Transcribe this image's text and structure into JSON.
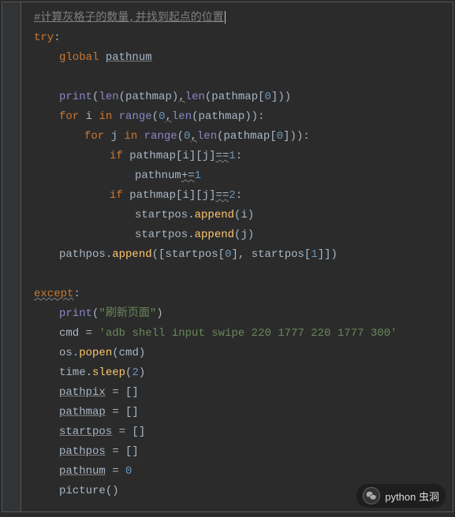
{
  "code": {
    "commentLine": "#计算灰格子的数量,并找到起点的位置",
    "l2_try": "try",
    "l3_global": "global",
    "l3_pathnum": "pathnum",
    "l5_print": "print",
    "l5_len1": "len",
    "l5_pathmap1": "pathmap",
    "l5_len2": "len",
    "l5_pathmap2": "pathmap",
    "l5_zero": "0",
    "l6_for": "for",
    "l6_i": "i",
    "l6_in": "in",
    "l6_range": "range",
    "l6_zero": "0",
    "l6_len": "len",
    "l6_pathmap": "pathmap",
    "l7_for": "for",
    "l7_j": "j",
    "l7_in": "in",
    "l7_range": "range",
    "l7_zero": "0",
    "l7_len": "len",
    "l7_pathmap": "pathmap",
    "l7_idx": "0",
    "l8_if": "if",
    "l8_pathmap": "pathmap",
    "l8_i": "i",
    "l8_j": "j",
    "l8_eq": "==",
    "l8_one": "1",
    "l9_pathnum": "pathnum",
    "l9_plus": "+=",
    "l9_one": "1",
    "l10_if": "if",
    "l10_pathmap": "pathmap",
    "l10_i": "i",
    "l10_j": "j",
    "l10_eq": "==",
    "l10_two": "2",
    "l11_startpos": "startpos",
    "l11_append": "append",
    "l11_i": "i",
    "l12_startpos": "startpos",
    "l12_append": "append",
    "l12_j": "j",
    "l13_pathpos": "pathpos",
    "l13_append": "append",
    "l13_startpos1": "startpos",
    "l13_zero": "0",
    "l13_startpos2": "startpos",
    "l13_one": "1",
    "l15_except": "except",
    "l16_print": "print",
    "l16_str": "\"刷新页面\"",
    "l17_cmd": "cmd",
    "l17_eq": " = ",
    "l17_str": "'adb shell input swipe 220 1777 220 1777 300'",
    "l18_os": "os",
    "l18_popen": "popen",
    "l18_cmd": "cmd",
    "l19_time": "time",
    "l19_sleep": "sleep",
    "l19_two": "2",
    "l20_pathpix": "pathpix",
    "l20_rest": " = []",
    "l21_pathmap": "pathmap",
    "l21_rest": " = []",
    "l22_startpos": "startpos",
    "l22_rest": " = []",
    "l23_pathpos": "pathpos",
    "l23_rest": " = []",
    "l24_pathnum": "pathnum",
    "l24_eq": " = ",
    "l24_zero": "0",
    "l25_picture": "picture"
  },
  "watermark": {
    "text": "python 虫洞"
  }
}
